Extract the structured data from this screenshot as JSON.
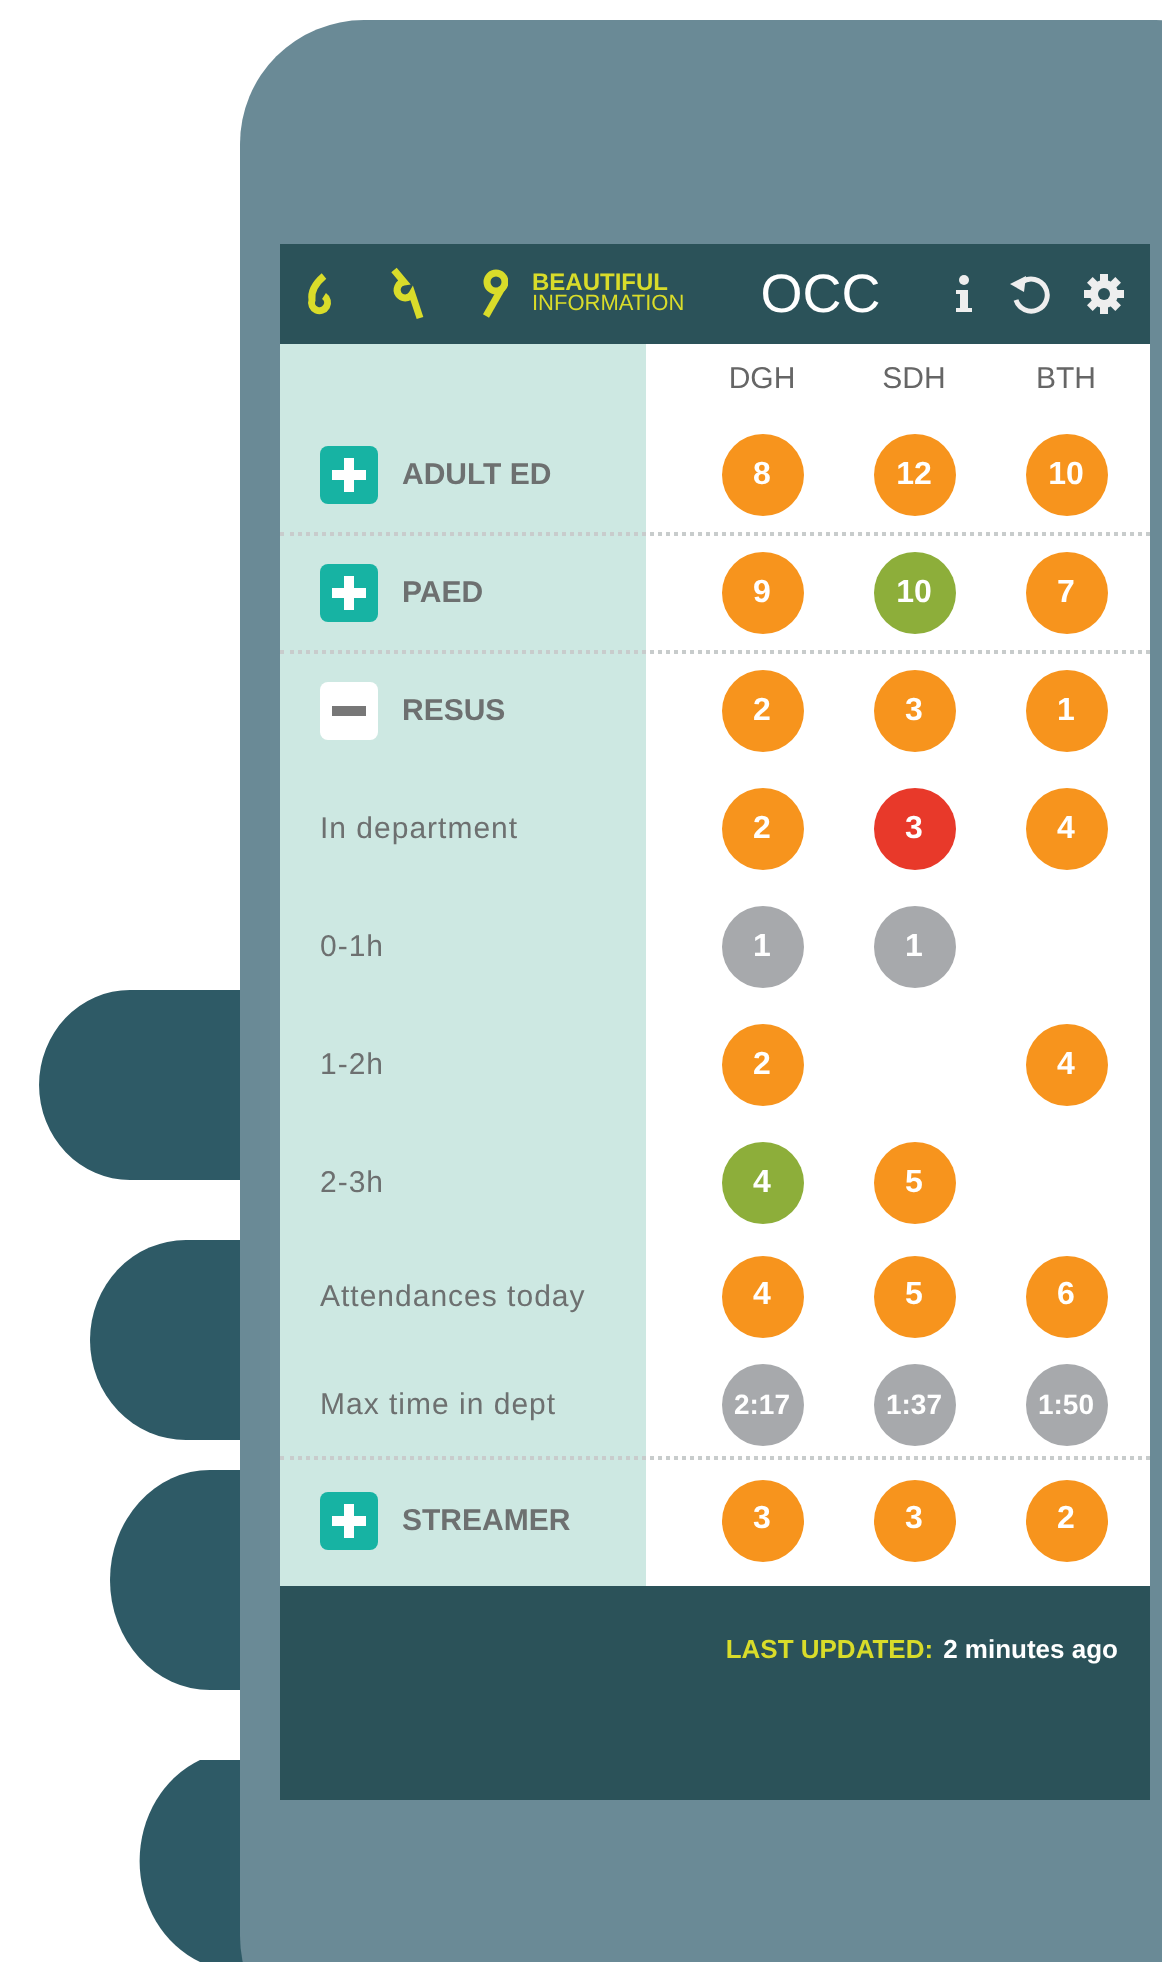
{
  "header": {
    "logo_lines": [
      "BEAUTIFUL",
      "INFORMATION"
    ],
    "title": "OCC"
  },
  "columns": [
    "DGH",
    "SDH",
    "BTH"
  ],
  "rows": [
    {
      "kind": "section",
      "label": "ADULT ED",
      "expanded": false,
      "cells": [
        {
          "value": "8",
          "color": "#f7941d"
        },
        {
          "value": "12",
          "color": "#f7941d"
        },
        {
          "value": "10",
          "color": "#f7941d"
        }
      ]
    },
    {
      "kind": "section",
      "label": "PAED",
      "expanded": false,
      "cells": [
        {
          "value": "9",
          "color": "#f7941d"
        },
        {
          "value": "10",
          "color": "#8dae3a"
        },
        {
          "value": "7",
          "color": "#f7941d"
        }
      ]
    },
    {
      "kind": "section",
      "label": "RESUS",
      "expanded": true,
      "cells": [
        {
          "value": "2",
          "color": "#f7941d"
        },
        {
          "value": "3",
          "color": "#f7941d"
        },
        {
          "value": "1",
          "color": "#f7941d"
        }
      ]
    },
    {
      "kind": "detail",
      "label": "In department",
      "cells": [
        {
          "value": "2",
          "color": "#f7941d"
        },
        {
          "value": "3",
          "color": "#e8392a"
        },
        {
          "value": "4",
          "color": "#f7941d"
        }
      ]
    },
    {
      "kind": "detail",
      "label": "0-1h",
      "cells": [
        {
          "value": "1",
          "color": "#a7a9ac"
        },
        {
          "value": "1",
          "color": "#a7a9ac"
        },
        null
      ]
    },
    {
      "kind": "detail",
      "label": "1-2h",
      "cells": [
        {
          "value": "2",
          "color": "#f7941d"
        },
        null,
        {
          "value": "4",
          "color": "#f7941d"
        }
      ]
    },
    {
      "kind": "detail",
      "label": "2-3h",
      "cells": [
        {
          "value": "4",
          "color": "#8dae3a"
        },
        {
          "value": "5",
          "color": "#f7941d"
        },
        null
      ]
    },
    {
      "kind": "detail",
      "label": "Attendances today",
      "cells": [
        {
          "value": "4",
          "color": "#f7941d"
        },
        {
          "value": "5",
          "color": "#f7941d"
        },
        {
          "value": "6",
          "color": "#f7941d"
        }
      ]
    },
    {
      "kind": "detail",
      "label": "Max time in dept",
      "cells": [
        {
          "value": "2:17",
          "color": "#a7a9ac"
        },
        {
          "value": "1:37",
          "color": "#a7a9ac"
        },
        {
          "value": "1:50",
          "color": "#a7a9ac"
        }
      ]
    },
    {
      "kind": "section",
      "label": "STREAMER",
      "expanded": false,
      "cells": [
        {
          "value": "3",
          "color": "#f7941d"
        },
        {
          "value": "3",
          "color": "#f7941d"
        },
        {
          "value": "2",
          "color": "#f7941d"
        }
      ]
    }
  ],
  "footer": {
    "label": "LAST UPDATED:",
    "value": "2 minutes ago"
  }
}
